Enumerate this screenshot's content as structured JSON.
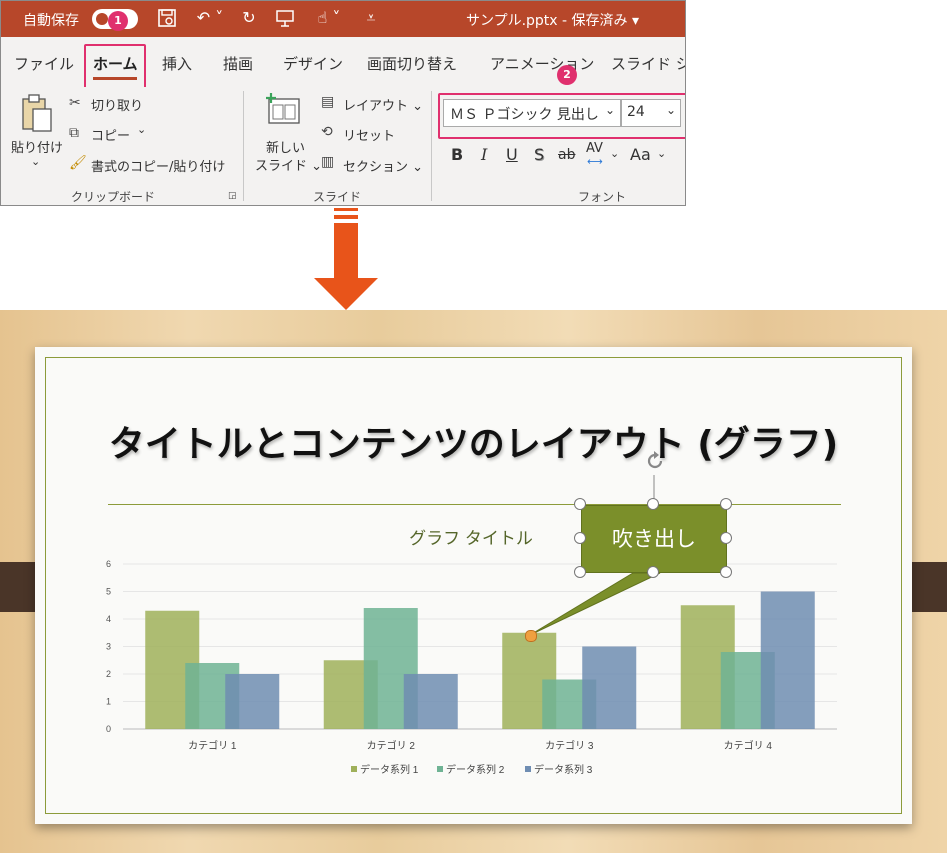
{
  "titlebar": {
    "autosave": "自動保存",
    "filename": "サンプル.pptx - 保存済み ▾",
    "badge1": "1",
    "colors": {
      "titlebar": "#b7472a"
    }
  },
  "tabs": [
    "ファイル",
    "ホーム",
    "挿入",
    "描画",
    "デザイン",
    "画面切り替え",
    "アニメーション",
    "スライド ショ"
  ],
  "badge2": "2",
  "clipboard": {
    "paste": "貼り付け",
    "paste_arrow": "⌄",
    "cut": "切り取り",
    "copy": "コピー",
    "copy_arrow": "⌄",
    "format_painter": "書式のコピー/貼り付け",
    "group_label": "クリップボード"
  },
  "slides_group": {
    "new_slide_1": "新しい",
    "new_slide_2": "スライド ⌄",
    "layout": "レイアウト ⌄",
    "reset": "リセット",
    "section": "セクション ⌄",
    "group_label": "スライド"
  },
  "font": {
    "name": "ＭＳ Ｐゴシック 見出し",
    "size": "24",
    "bold": "B",
    "italic": "I",
    "underline": "U",
    "shadow": "S",
    "strike": "ab",
    "spacing": "AV",
    "case": "Aa",
    "group_label": "フォント"
  },
  "slide": {
    "title": "タイトルとコンテンツのレイアウト (グラフ)",
    "callout": "吹き出し"
  },
  "chart_data": {
    "type": "bar",
    "title": "グラフ タイトル",
    "categories": [
      "カテゴリ 1",
      "カテゴリ 2",
      "カテゴリ 3",
      "カテゴリ 4"
    ],
    "series": [
      {
        "name": "データ系列 1",
        "values": [
          4.3,
          2.5,
          3.5,
          4.5
        ],
        "color": "#9fb05a"
      },
      {
        "name": "データ系列 2",
        "values": [
          2.4,
          4.4,
          1.8,
          2.8
        ],
        "color": "#6fb394"
      },
      {
        "name": "データ系列 3",
        "values": [
          2.0,
          2.0,
          3.0,
          5.0
        ],
        "color": "#6f8db2"
      }
    ],
    "ylim": [
      0,
      6
    ],
    "yticks": [
      "0",
      "1",
      "2",
      "3",
      "4",
      "5",
      "6"
    ],
    "legend": "bottom",
    "grid": true
  }
}
